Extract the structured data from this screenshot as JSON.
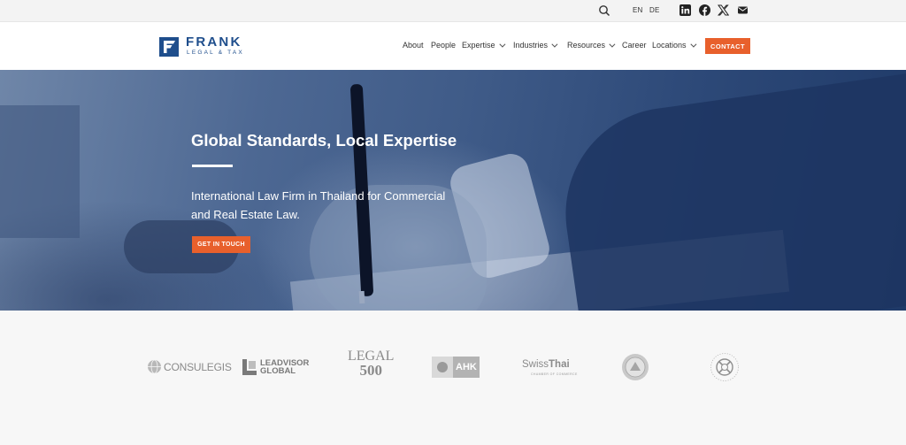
{
  "topbar": {
    "languages": [
      "EN",
      "DE"
    ],
    "icons": [
      "search-icon",
      "linkedin-icon",
      "facebook-icon",
      "x-icon",
      "mail-icon"
    ]
  },
  "header": {
    "logo": {
      "name": "FRANK",
      "tagline": "LEGAL & TAX"
    },
    "nav": [
      {
        "label": "About",
        "dropdown": false
      },
      {
        "label": "People",
        "dropdown": false
      },
      {
        "label": "Expertise",
        "dropdown": true
      },
      {
        "label": "Industries",
        "dropdown": true
      },
      {
        "label": "Resources",
        "dropdown": true
      },
      {
        "label": "Career",
        "dropdown": false
      },
      {
        "label": "Locations",
        "dropdown": true
      }
    ],
    "contact_label": "CONTACT"
  },
  "hero": {
    "title": "Global Standards, Local Expertise",
    "subtitle": "International Law Firm in Thailand for Commercial and Real Estate Law.",
    "cta_label": "GET IN TOUCH"
  },
  "partners": {
    "consulegis": "CONSULEGIS",
    "leadvisor": {
      "line1": "LEADVISOR",
      "line2": "GLOBAL"
    },
    "legal500": {
      "line1": "LEGAL",
      "line2": "500"
    },
    "ahk": "AHK",
    "swissthai": {
      "name_a": "Swiss",
      "name_b": "Thai",
      "sub": "CHAMBER OF COMMERCE"
    }
  },
  "colors": {
    "brand_blue": "#1f4e8c",
    "accent_orange": "#e8602c",
    "hero_overlay": "#3f5b88"
  }
}
